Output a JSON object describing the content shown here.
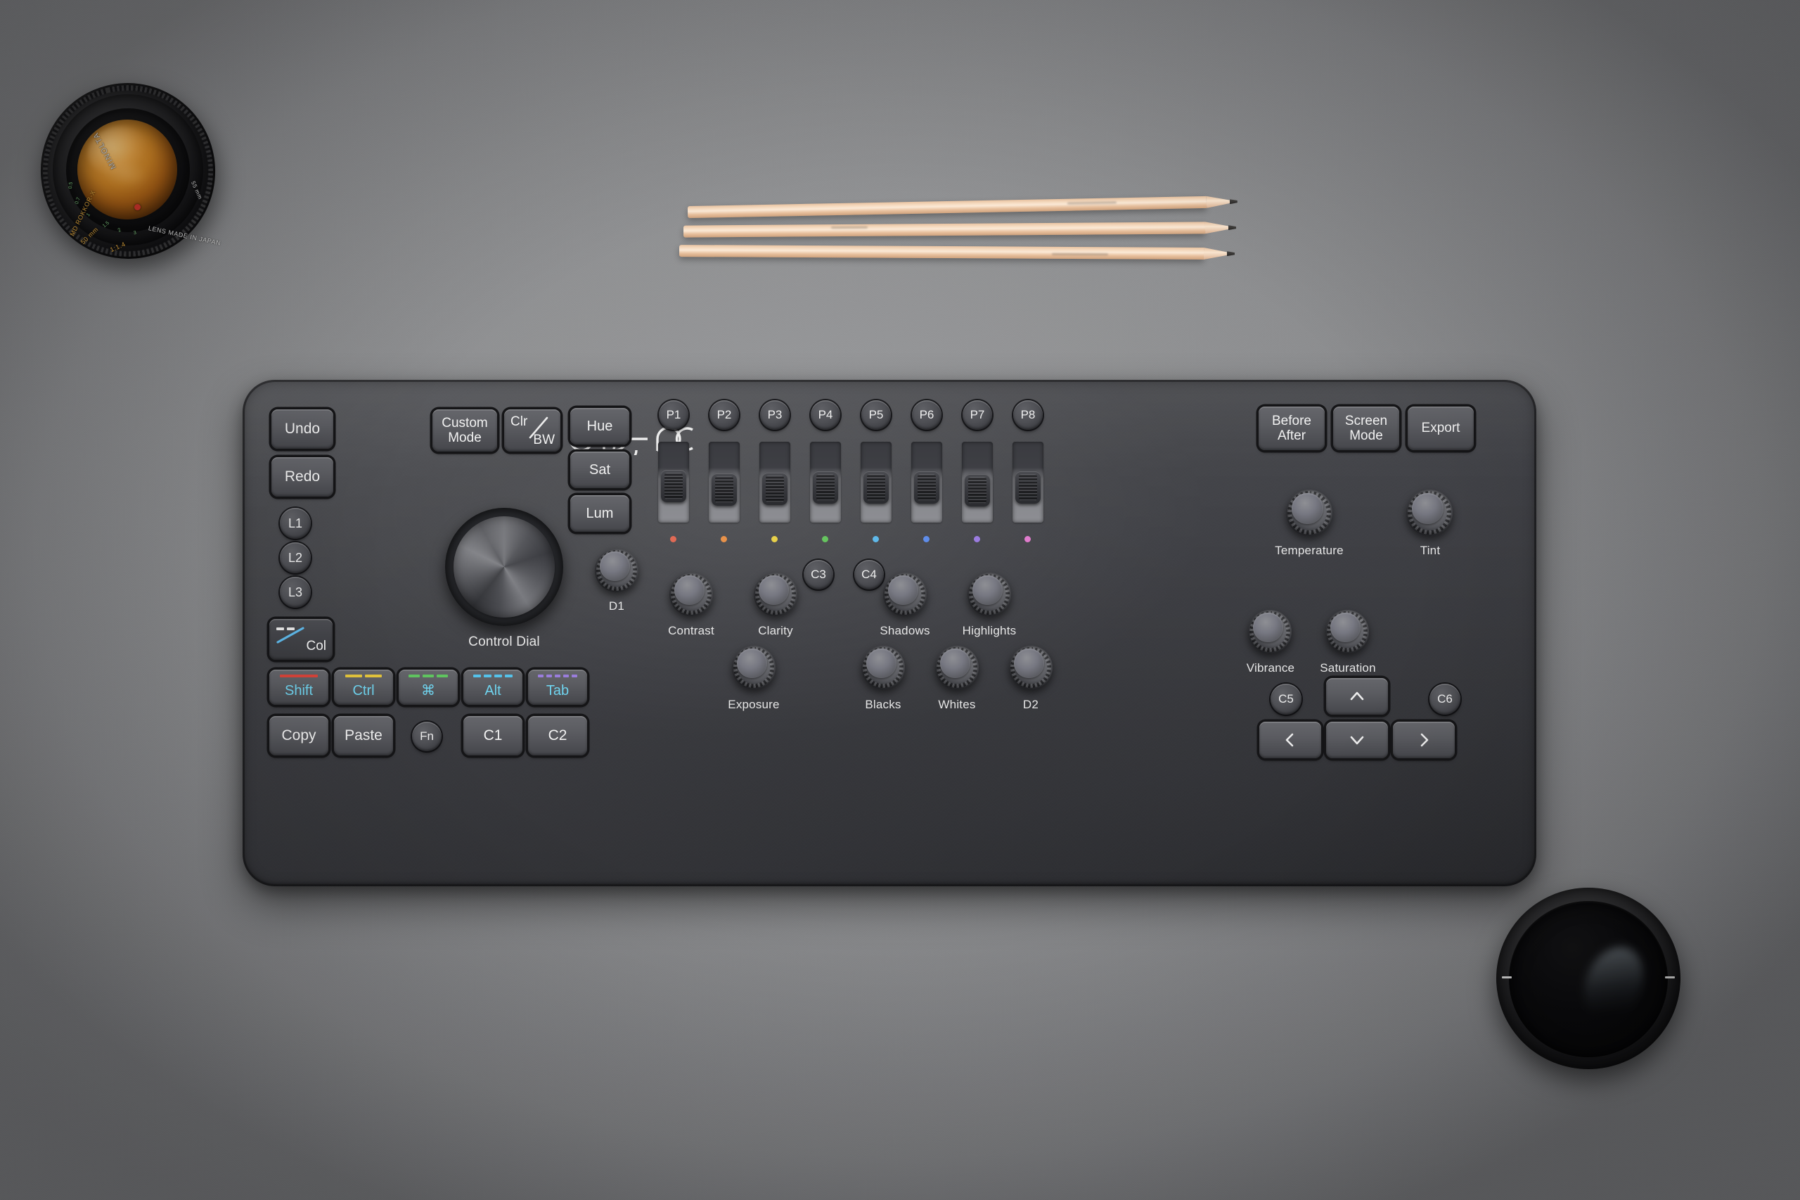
{
  "scene": {
    "description": "Loupedeck+ photo editing console on grey desk with Minolta lens, three pencils and a lens cap",
    "desk_color": "#8e8f91"
  },
  "lens": {
    "brand": "MINOLTA",
    "model": "MD ROKKOR-X",
    "focal": "50 mm",
    "aperture": "1:1.4",
    "made_in": "LENS MADE IN JAPAN",
    "filter_size": "55 mm",
    "distance_marks": [
      "7",
      "5",
      "3",
      "2",
      "1.5",
      "1",
      "0.7",
      "0.5",
      "0.45"
    ]
  },
  "pencils": {
    "count": 3,
    "color": "#f2d9be",
    "lead_color": "#33302e"
  },
  "lens_cap": {
    "name": "lens-filter"
  },
  "device": {
    "brand": "Loupedeck",
    "plus_mark": "+",
    "plus_color": "#6fd3ee",
    "body_color": "#43444a"
  },
  "left_column": {
    "undo": "Undo",
    "redo": "Redo",
    "l_buttons": [
      "L1",
      "L2",
      "L3"
    ],
    "col_button": "Col"
  },
  "top_left": {
    "custom_mode": "Custom\nMode",
    "custom_mode_line1": "Custom",
    "custom_mode_line2": "Mode",
    "clr": "Clr",
    "bw": "BW"
  },
  "hsl_buttons": [
    {
      "label": "Hue"
    },
    {
      "label": "Sat"
    },
    {
      "label": "Lum"
    }
  ],
  "modifier_row": [
    {
      "label": "Shift",
      "dash_color": "#d8443a",
      "dash_count": 1,
      "text_color": "#6fd3ee"
    },
    {
      "label": "Ctrl",
      "dash_color": "#e4c53c",
      "dash_count": 2,
      "text_color": "#6fd3ee"
    },
    {
      "label": "⌘",
      "dash_color": "#5fc45f",
      "dash_count": 3,
      "text_color": "#6fd3ee"
    },
    {
      "label": "Alt",
      "dash_color": "#55c2ea",
      "dash_count": 4,
      "text_color": "#6fd3ee"
    },
    {
      "label": "Tab",
      "dash_color": "#9a7ddc",
      "dash_count": 5,
      "text_color": "#6fd3ee"
    }
  ],
  "bottom_left_row": {
    "copy": "Copy",
    "paste": "Paste",
    "fn": "Fn",
    "c1": "C1",
    "c2": "C2"
  },
  "control_dial": {
    "label": "Control Dial"
  },
  "d_knobs": {
    "d1": "D1",
    "d2": "D2"
  },
  "c_buttons": {
    "c3": "C3",
    "c4": "C4",
    "c5": "C5",
    "c6": "C6"
  },
  "sliders": [
    {
      "label": "P1",
      "dot_color": "#e06a55"
    },
    {
      "label": "P2",
      "dot_color": "#e8924a"
    },
    {
      "label": "P3",
      "dot_color": "#e8d14a"
    },
    {
      "label": "P4",
      "dot_color": "#66c45f"
    },
    {
      "label": "P5",
      "dot_color": "#5fb9ea"
    },
    {
      "label": "P6",
      "dot_color": "#5f8dea"
    },
    {
      "label": "P7",
      "dot_color": "#9b7ce0"
    },
    {
      "label": "P8",
      "dot_color": "#e07ccd"
    }
  ],
  "top_right_buttons": [
    {
      "line1": "Before",
      "line2": "After"
    },
    {
      "line1": "Screen",
      "line2": "Mode"
    },
    {
      "line1": "Export",
      "line2": ""
    }
  ],
  "knobs_middle": [
    {
      "label": "Contrast"
    },
    {
      "label": "Clarity"
    },
    {
      "label": "Shadows"
    },
    {
      "label": "Highlights"
    }
  ],
  "knobs_bottom": [
    {
      "label": "Exposure"
    },
    {
      "label": "Blacks"
    },
    {
      "label": "Whites"
    },
    {
      "label": "D2"
    }
  ],
  "knobs_right": [
    {
      "label": "Temperature"
    },
    {
      "label": "Tint"
    },
    {
      "label": "Vibrance"
    },
    {
      "label": "Saturation"
    }
  ],
  "dpad": {
    "up": "∧",
    "down": "∨",
    "left": "‹",
    "right": "›"
  }
}
